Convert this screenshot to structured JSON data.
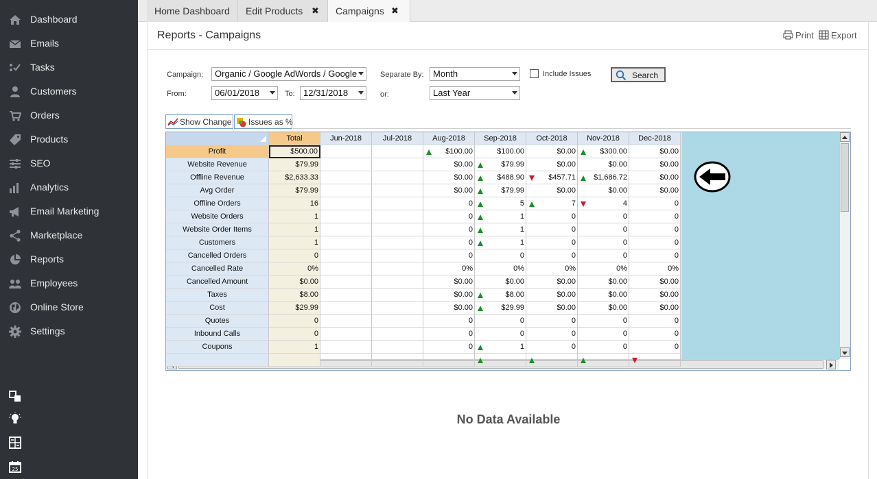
{
  "sidebar": {
    "items": [
      {
        "label": "Dashboard",
        "icon": "home-icon"
      },
      {
        "label": "Emails",
        "icon": "envelope-icon"
      },
      {
        "label": "Tasks",
        "icon": "checklist-icon"
      },
      {
        "label": "Customers",
        "icon": "user-icon"
      },
      {
        "label": "Orders",
        "icon": "cart-icon"
      },
      {
        "label": "Products",
        "icon": "tag-icon"
      },
      {
        "label": "SEO",
        "icon": "sliders-icon"
      },
      {
        "label": "Analytics",
        "icon": "bar-chart-icon"
      },
      {
        "label": "Email Marketing",
        "icon": "megaphone-icon"
      },
      {
        "label": "Marketplace",
        "icon": "share-icon"
      },
      {
        "label": "Reports",
        "icon": "pie-chart-icon"
      },
      {
        "label": "Employees",
        "icon": "users-icon"
      },
      {
        "label": "Online Store",
        "icon": "globe-icon"
      },
      {
        "label": "Settings",
        "icon": "gear-icon"
      }
    ],
    "bottom_icons": [
      "window-icon",
      "lightbulb-icon",
      "calculator-icon",
      "calendar-icon"
    ],
    "calendar_day": "25"
  },
  "tabs": [
    {
      "label": "Home Dashboard",
      "closable": false,
      "active": false
    },
    {
      "label": "Edit Products",
      "closable": true,
      "active": false
    },
    {
      "label": "Campaigns",
      "closable": true,
      "active": true
    }
  ],
  "header": {
    "title": "Reports - Campaigns",
    "print_label": "Print",
    "export_label": "Export"
  },
  "filters": {
    "campaign_label": "Campaign:",
    "campaign_value": "Organic / Google AdWords / Google",
    "from_label": "From:",
    "from_value": "06/01/2018",
    "to_label": "To:",
    "to_value": "12/31/2018",
    "separate_label": "Separate By:",
    "separate_value": "Month",
    "or_label": "or:",
    "or_value": "Last Year",
    "include_issues_label": "Include Issues",
    "include_issues_checked": false,
    "search_label": "Search"
  },
  "toolbar": {
    "show_change_label": "Show Change",
    "issues_pct_label": "Issues as %"
  },
  "grid": {
    "columns": [
      "Total",
      "Jun-2018",
      "Jul-2018",
      "Aug-2018",
      "Sep-2018",
      "Oct-2018",
      "Nov-2018",
      "Dec-2018"
    ],
    "rows": [
      {
        "label": "Profit",
        "cells": [
          "$500.00",
          "",
          "",
          "$100.00",
          "$100.00",
          "$0.00",
          "$300.00",
          "$0.00"
        ],
        "trend": [
          "",
          "",
          "",
          "up",
          "",
          "",
          "up",
          ""
        ]
      },
      {
        "label": "Website Revenue",
        "cells": [
          "$79.99",
          "",
          "",
          "$0.00",
          "$79.99",
          "$0.00",
          "$0.00",
          "$0.00"
        ],
        "trend": [
          "",
          "",
          "",
          "",
          "up",
          "",
          "",
          ""
        ]
      },
      {
        "label": "Offline Revenue",
        "cells": [
          "$2,633.33",
          "",
          "",
          "$0.00",
          "$488.90",
          "$457.71",
          "$1,686.72",
          "$0.00"
        ],
        "trend": [
          "",
          "",
          "",
          "",
          "up",
          "down",
          "up",
          ""
        ]
      },
      {
        "label": "Avg Order",
        "cells": [
          "$79.99",
          "",
          "",
          "$0.00",
          "$79.99",
          "$0.00",
          "$0.00",
          "$0.00"
        ],
        "trend": [
          "",
          "",
          "",
          "",
          "up",
          "",
          "",
          ""
        ]
      },
      {
        "label": "Offline Orders",
        "cells": [
          "16",
          "",
          "",
          "0",
          "5",
          "7",
          "4",
          "0"
        ],
        "trend": [
          "",
          "",
          "",
          "",
          "up",
          "up",
          "down",
          ""
        ]
      },
      {
        "label": "Website Orders",
        "cells": [
          "1",
          "",
          "",
          "0",
          "1",
          "0",
          "0",
          "0"
        ],
        "trend": [
          "",
          "",
          "",
          "",
          "up",
          "",
          "",
          ""
        ]
      },
      {
        "label": "Website Order Items",
        "cells": [
          "1",
          "",
          "",
          "0",
          "1",
          "0",
          "0",
          "0"
        ],
        "trend": [
          "",
          "",
          "",
          "",
          "up",
          "",
          "",
          ""
        ]
      },
      {
        "label": "Customers",
        "cells": [
          "1",
          "",
          "",
          "0",
          "1",
          "0",
          "0",
          "0"
        ],
        "trend": [
          "",
          "",
          "",
          "",
          "up",
          "",
          "",
          ""
        ]
      },
      {
        "label": "Cancelled Orders",
        "cells": [
          "0",
          "",
          "",
          "0",
          "0",
          "0",
          "0",
          "0"
        ],
        "trend": [
          "",
          "",
          "",
          "",
          "",
          "",
          "",
          ""
        ]
      },
      {
        "label": "Cancelled Rate",
        "cells": [
          "0%",
          "",
          "",
          "0%",
          "0%",
          "0%",
          "0%",
          "0%"
        ],
        "trend": [
          "",
          "",
          "",
          "",
          "",
          "",
          "",
          ""
        ]
      },
      {
        "label": "Cancelled Amount",
        "cells": [
          "$0.00",
          "",
          "",
          "$0.00",
          "$0.00",
          "$0.00",
          "$0.00",
          "$0.00"
        ],
        "trend": [
          "",
          "",
          "",
          "",
          "",
          "",
          "",
          ""
        ]
      },
      {
        "label": "Taxes",
        "cells": [
          "$8.00",
          "",
          "",
          "$0.00",
          "$8.00",
          "$0.00",
          "$0.00",
          "$0.00"
        ],
        "trend": [
          "",
          "",
          "",
          "",
          "up",
          "",
          "",
          ""
        ]
      },
      {
        "label": "Cost",
        "cells": [
          "$29.99",
          "",
          "",
          "$0.00",
          "$29.99",
          "$0.00",
          "$0.00",
          "$0.00"
        ],
        "trend": [
          "",
          "",
          "",
          "",
          "up",
          "",
          "",
          ""
        ]
      },
      {
        "label": "Quotes",
        "cells": [
          "0",
          "",
          "",
          "0",
          "0",
          "0",
          "0",
          "0"
        ],
        "trend": [
          "",
          "",
          "",
          "",
          "",
          "",
          "",
          ""
        ]
      },
      {
        "label": "Inbound Calls",
        "cells": [
          "0",
          "",
          "",
          "0",
          "0",
          "0",
          "0",
          "0"
        ],
        "trend": [
          "",
          "",
          "",
          "",
          "",
          "",
          "",
          ""
        ]
      },
      {
        "label": "Coupons",
        "cells": [
          "1",
          "",
          "",
          "0",
          "1",
          "0",
          "0",
          "0"
        ],
        "trend": [
          "",
          "",
          "",
          "",
          "up",
          "",
          "",
          ""
        ]
      },
      {
        "label": "",
        "cells": [
          "",
          "",
          "",
          "",
          "",
          "",
          "",
          ""
        ],
        "trend": [
          "",
          "",
          "",
          "",
          "up",
          "up",
          "up",
          "down"
        ]
      }
    ]
  },
  "no_data_text": "No Data Available"
}
